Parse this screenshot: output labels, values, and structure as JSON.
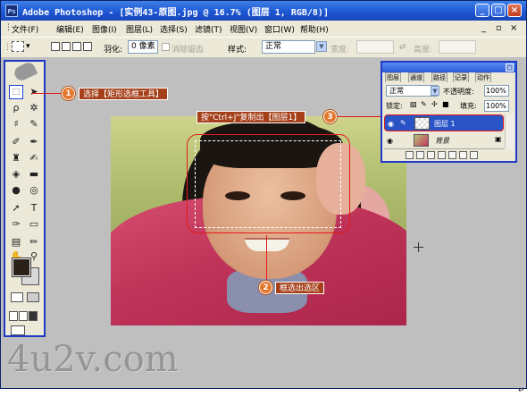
{
  "window": {
    "app_icon": "Ps",
    "title": "Adobe Photoshop - [实例43-原图.jpg @ 16.7% (图层 1, RGB/8)]",
    "buttons": [
      "_",
      "□",
      "×"
    ]
  },
  "menubar": {
    "items": [
      "文件(F)",
      "编辑(E)",
      "图像(I)",
      "图层(L)",
      "选择(S)",
      "滤镜(T)",
      "视图(V)",
      "窗口(W)",
      "帮助(H)"
    ],
    "mdi_buttons": [
      "_",
      "▫",
      "×"
    ]
  },
  "options_bar": {
    "feather_label": "羽化:",
    "feather_value": "0 像素",
    "antialias_label": "消除锯齿",
    "style_label": "样式:",
    "style_value": "正常",
    "width_label": "宽度:",
    "height_label": "高度:"
  },
  "layers_panel": {
    "tabs": [
      "图层",
      "通道",
      "路径",
      "记录",
      "动作"
    ],
    "blend_mode": "正常",
    "opacity_label": "不透明度:",
    "opacity_value": "100%",
    "lock_label": "锁定:",
    "fill_label": "填充:",
    "fill_value": "100%",
    "layers": [
      {
        "name": "图层 1",
        "selected": true
      },
      {
        "name": "背景",
        "selected": false
      }
    ]
  },
  "annotations": {
    "step1": {
      "number": "1",
      "text": "选择【矩形选框工具】"
    },
    "step2": {
      "number": "2",
      "text": "框选出选区"
    },
    "step3": {
      "number": "3",
      "text": "按\"Ctrl+J\"复制出【图层1】"
    }
  },
  "watermark": "4u2v.com",
  "icons": [
    "photoshop-app-icon",
    "marquee-tool-icon",
    "move-tool-icon",
    "eye-icon",
    "lock-icon"
  ],
  "colors": {
    "accent_blue": "#1f39c7",
    "highlight_red": "#e11b1b",
    "label_bg": "#a5401a",
    "number_bg": "#e2772d"
  }
}
